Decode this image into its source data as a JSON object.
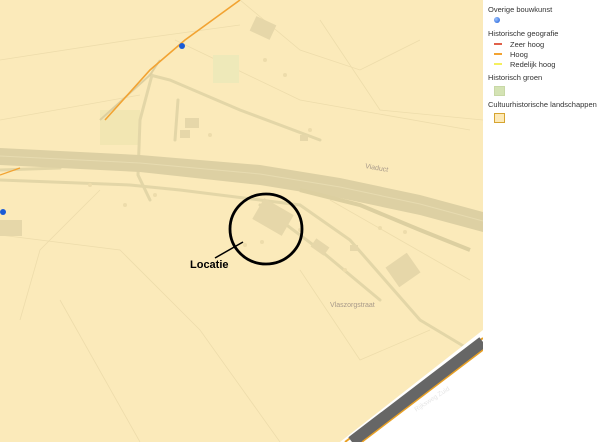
{
  "map": {
    "location_label": "Locatie",
    "street_labels": {
      "viaduct": "Viaduct",
      "vlaszo": "Vlaszorgstraat",
      "highway": "Rijksweg Zuid"
    }
  },
  "legend": {
    "overige_bouwkunst": "Overige bouwkunst",
    "historische_geografie": "Historische geografie",
    "geo_items": [
      {
        "label": "Zeer hoog",
        "color": "#e0614a"
      },
      {
        "label": "Hoog",
        "color": "#f2a332"
      },
      {
        "label": "Redelijk hoog",
        "color": "#f5ef5e"
      }
    ],
    "historisch_groen": "Historisch groen",
    "cultuurhistorische_landschappen": "Cultuurhistorische landschappen"
  },
  "colors": {
    "landscape": "#fbeaba",
    "road": "#dccfa0",
    "highway": "#5e5e5e",
    "green": "#d4e3b4"
  }
}
